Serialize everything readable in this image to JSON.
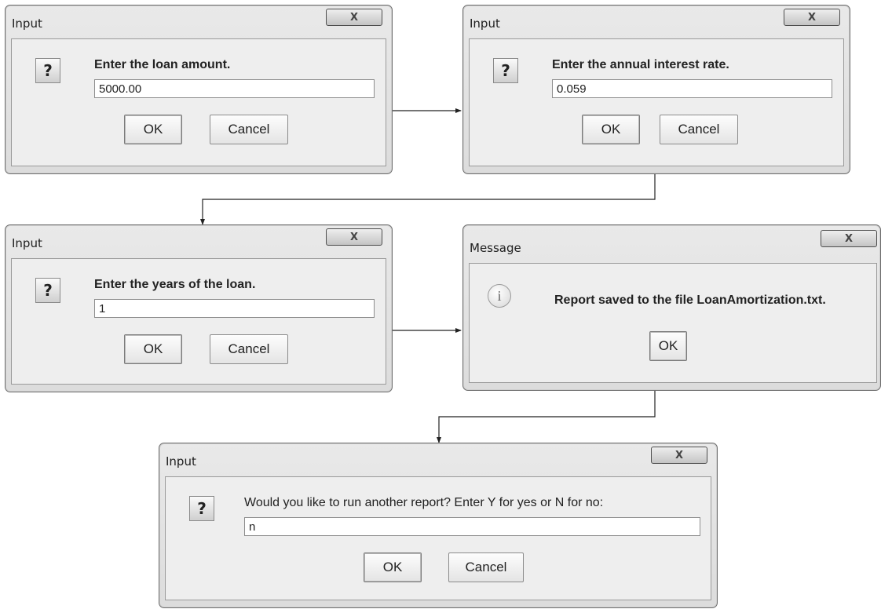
{
  "dialog1": {
    "title": "Input",
    "close": "X",
    "prompt": "Enter the loan amount.",
    "value": "5000.00",
    "ok": "OK",
    "cancel": "Cancel",
    "icon": "question-icon"
  },
  "dialog2": {
    "title": "Input",
    "close": "X",
    "prompt": "Enter the annual interest rate.",
    "value": "0.059",
    "ok": "OK",
    "cancel": "Cancel",
    "icon": "question-icon"
  },
  "dialog3": {
    "title": "Input",
    "close": "X",
    "prompt": "Enter the years of the loan.",
    "value": "1",
    "ok": "OK",
    "cancel": "Cancel",
    "icon": "question-icon"
  },
  "dialog4": {
    "title": "Message",
    "close": "X",
    "message": "Report saved to the file LoanAmortization.txt.",
    "ok": "OK",
    "icon": "info-icon",
    "icon_glyph": "i"
  },
  "dialog5": {
    "title": "Input",
    "close": "X",
    "prompt": "Would you like to run another report? Enter Y for yes or N for no:",
    "value": "n",
    "ok": "OK",
    "cancel": "Cancel",
    "icon": "question-icon"
  },
  "question_glyph": "?"
}
